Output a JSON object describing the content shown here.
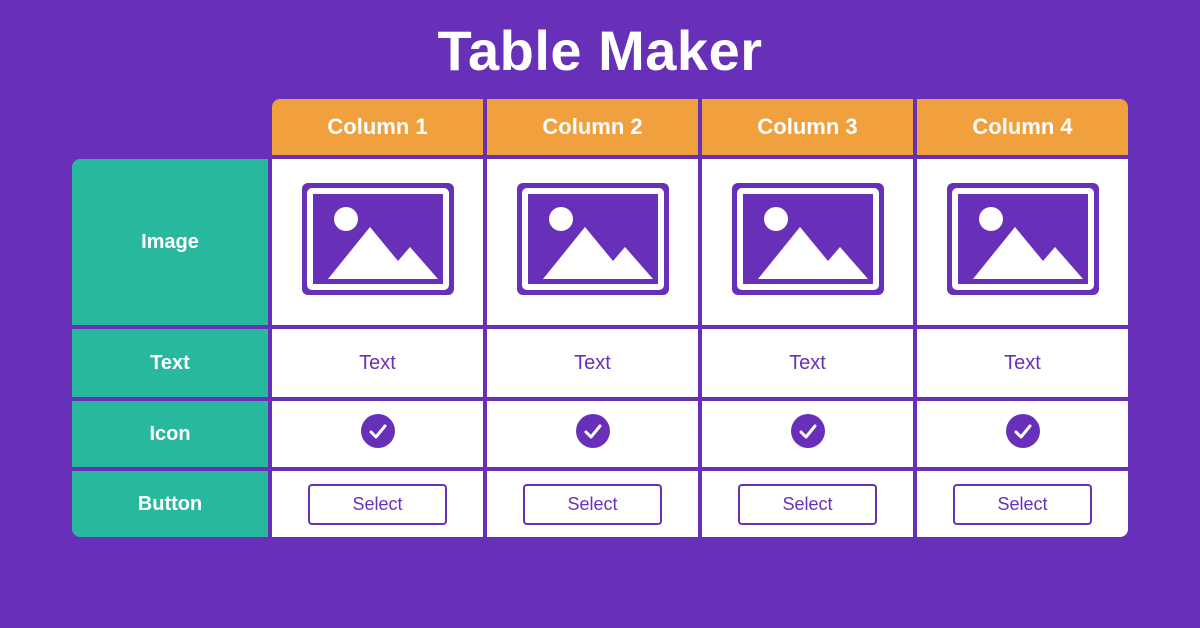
{
  "title": "Table Maker",
  "columns": [
    "Column 1",
    "Column 2",
    "Column 3",
    "Column 4"
  ],
  "rows": {
    "image": {
      "label": "Image"
    },
    "text": {
      "label": "Text",
      "cells": [
        "Text",
        "Text",
        "Text",
        "Text"
      ]
    },
    "icon": {
      "label": "Icon"
    },
    "button": {
      "label": "Button",
      "cells": [
        "Select",
        "Select",
        "Select",
        "Select"
      ]
    }
  },
  "colors": {
    "background": "#6830B8",
    "col_header": "#F0A03C",
    "row_header": "#28B89E",
    "cell_bg": "#FFFFFF",
    "accent": "#6830B8"
  }
}
